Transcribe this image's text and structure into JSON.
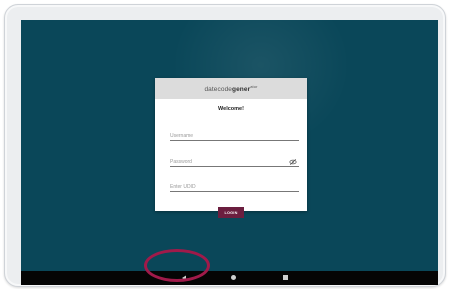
{
  "app": {
    "brand_prefix": "datecode",
    "brand_bold": "gener",
    "brand_tm": "ator"
  },
  "login": {
    "welcome": "Welcome!",
    "username_placeholder": "Username",
    "password_placeholder": "Password",
    "udid_placeholder": "Enter UDID",
    "login_label": "LOGIN"
  },
  "navbar": {
    "back_icon": "triangle-left-icon",
    "home_icon": "circle-home-icon",
    "recents_icon": "square-recents-icon"
  },
  "colors": {
    "screen_bg": "#0a4759",
    "login_button": "#6b1e3f",
    "highlight_ring": "#a01a4a"
  }
}
